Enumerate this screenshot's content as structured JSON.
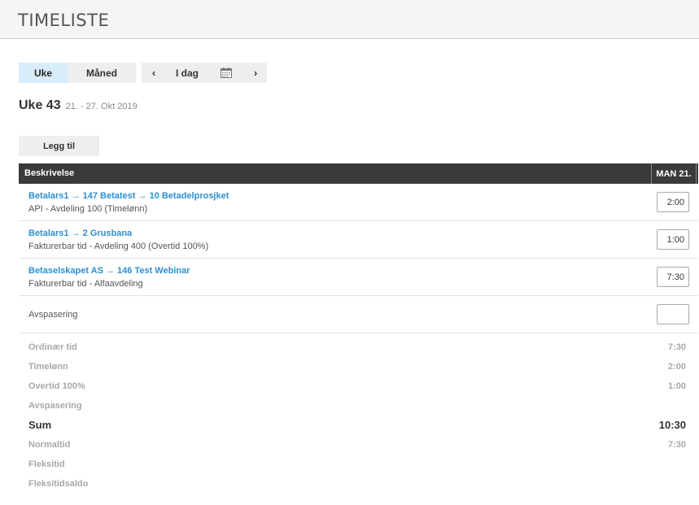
{
  "header": {
    "title": "TIMELISTE"
  },
  "toolbar": {
    "view_week": "Uke",
    "view_month": "Måned",
    "prev": "‹",
    "today": "I dag",
    "next": "›"
  },
  "week": {
    "label": "Uke 43",
    "dates": "21. - 27. Okt 2019"
  },
  "add_button": "Legg til",
  "table": {
    "col_description": "Beskrivelse",
    "col_day": "MAN 21.",
    "rows": [
      {
        "title": "Betalars1 → 147 Betatest → 10 Betadelprosjket",
        "subtitle": "API - Avdeling 100 (Timelønn)",
        "value": "2:00"
      },
      {
        "title": "Betalars1 → 2 Grusbana",
        "subtitle": "Fakturerbar tid - Avdeling 400 (Overtid 100%)",
        "value": "1:00"
      },
      {
        "title": "Betaselskapet AS → 146 Test Webinar",
        "subtitle": "Fakturerbar tid - Alfaavdeling",
        "value": "7:30"
      }
    ],
    "avspasering": {
      "label": "Avspasering",
      "value": ""
    }
  },
  "summary": [
    {
      "label": "Ordinær tid",
      "value": "7:30"
    },
    {
      "label": "Timelønn",
      "value": "2:00"
    },
    {
      "label": "Overtid 100%",
      "value": "1:00"
    },
    {
      "label": "Avspasering",
      "value": ""
    },
    {
      "label": "Sum",
      "value": "10:30"
    },
    {
      "label": "Normaltid",
      "value": "7:30"
    },
    {
      "label": "Fleksitid",
      "value": ""
    },
    {
      "label": "Fleksitidsaldo",
      "value": ""
    }
  ]
}
